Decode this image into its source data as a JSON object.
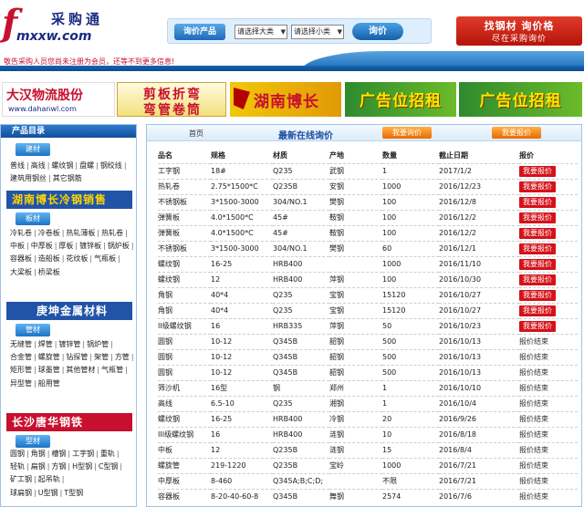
{
  "header": {
    "logo_mark": "f",
    "logo_cn": "采购通",
    "logo_en": "mxxw.com",
    "search_label": "询价产品",
    "select_1": "请选择大类",
    "select_2": "请选择小类",
    "search_button": "询价",
    "promo_line1": "找钢材 询价格",
    "promo_line2": "尽在采购询价",
    "notice": "敬告采购人员您尚未注册为会员，还等不到更多信息!"
  },
  "banners": {
    "b1_title": "大汉物流股份",
    "b1_sub": "www.dahanwl.com",
    "b2_line1": "剪板折弯",
    "b2_line2": "弯管卷筒",
    "b3_title": "湖南博长",
    "b4_title": "广告位招租",
    "b5_title": "广告位招租"
  },
  "sidebar": {
    "title": "产品目录",
    "categories": [
      {
        "tag": "建材",
        "links": [
          "普线",
          "高线",
          "螺纹钢",
          "盘螺",
          "钢绞线",
          "建筑用钢丝",
          "其它钢筋"
        ]
      },
      {
        "tag": "板材",
        "links": [
          "冷轧卷",
          "冷卷板",
          "热轧薄板",
          "热轧卷",
          "中板",
          "中厚板",
          "厚板",
          "镀锌板",
          "锅炉板",
          "容器板",
          "造船板",
          "花纹板",
          "气瓶板",
          "大梁板",
          "桥梁板"
        ]
      },
      {
        "tag": "管材",
        "links": [
          "无缝管",
          "焊管",
          "镀锌管",
          "锅炉管",
          "合金管",
          "螺旋管",
          "钻探管",
          "架管",
          "方管",
          "矩形管",
          "球墨管",
          "其他管材",
          "气瓶管",
          "异型管",
          "船用管"
        ]
      },
      {
        "tag": "型材",
        "links": [
          "圆钢",
          "角钢",
          "槽钢",
          "工字钢",
          "重轨",
          "轻轨",
          "扁钢",
          "方钢",
          "H型钢",
          "C型钢",
          "矿工钢",
          "起吊轨",
          "球扁钢",
          "U型钢",
          "T型钢"
        ]
      }
    ],
    "banner_1": "湖南博长冷钢销售",
    "banner_2": "庚坤金属材料",
    "banner_3": "长沙唐华钢铁"
  },
  "main": {
    "home": "首页",
    "title": "最新在线询价",
    "btn_inquiry": "我要询价",
    "btn_quote": "我要报价",
    "columns": [
      "品名",
      "规格",
      "材质",
      "产地",
      "数量",
      "截止日期",
      "报价"
    ],
    "rows": [
      [
        "工字钢",
        "18#",
        "Q235",
        "武钢",
        "1",
        "2017/1/2",
        "我要报价"
      ],
      [
        "热轧卷",
        "2.75*1500*C",
        "Q235B",
        "安钢",
        "1000",
        "2016/12/23",
        "我要报价"
      ],
      [
        "不锈钢板",
        "3*1500-3000",
        "304/NO.1",
        "樊钢",
        "100",
        "2016/12/8",
        "我要报价"
      ],
      [
        "弹簧板",
        "4.0*1500*C",
        "45#",
        "鞍钢",
        "100",
        "2016/12/2",
        "我要报价"
      ],
      [
        "弹簧板",
        "4.0*1500*C",
        "45#",
        "鞍钢",
        "100",
        "2016/12/2",
        "我要报价"
      ],
      [
        "不锈钢板",
        "3*1500-3000",
        "304/NO.1",
        "樊钢",
        "60",
        "2016/12/1",
        "我要报价"
      ],
      [
        "螺纹钢",
        "16-25",
        "HRB400",
        "",
        "1000",
        "2016/11/10",
        "我要报价"
      ],
      [
        "螺纹钢",
        "12",
        "HRB400",
        "萍钢",
        "100",
        "2016/10/30",
        "我要报价"
      ],
      [
        "角钢",
        "40*4",
        "Q235",
        "宝钢",
        "15120",
        "2016/10/27",
        "我要报价"
      ],
      [
        "角钢",
        "40*4",
        "Q235",
        "宝钢",
        "15120",
        "2016/10/27",
        "我要报价"
      ],
      [
        "II级螺纹钢",
        "16",
        "HRB335",
        "萍钢",
        "50",
        "2016/10/23",
        "我要报价"
      ],
      [
        "圆钢",
        "10-12",
        "Q345B",
        "韶钢",
        "500",
        "2016/10/13",
        "报价结束"
      ],
      [
        "圆钢",
        "10-12",
        "Q345B",
        "韶钢",
        "500",
        "2016/10/13",
        "报价结束"
      ],
      [
        "圆钢",
        "10-12",
        "Q345B",
        "韶钢",
        "500",
        "2016/10/13",
        "报价结束"
      ],
      [
        "筛沙机",
        "16型",
        "钢",
        "郑州",
        "1",
        "2016/10/10",
        "报价结束"
      ],
      [
        "高线",
        "6.5-10",
        "Q235",
        "湘钢",
        "1",
        "2016/10/4",
        "报价结束"
      ],
      [
        "螺纹钢",
        "16-25",
        "HRB400",
        "冷钢",
        "20",
        "2016/9/26",
        "报价结束"
      ],
      [
        "III级螺纹钢",
        "16",
        "HRB400",
        "涟钢",
        "10",
        "2016/8/18",
        "报价结束"
      ],
      [
        "中板",
        "12",
        "Q235B",
        "涟钢",
        "15",
        "2016/8/4",
        "报价结束"
      ],
      [
        "螺旋管",
        "219-1220",
        "Q235B",
        "宝岭",
        "1000",
        "2016/7/21",
        "报价结束"
      ],
      [
        "中厚板",
        "8-460",
        "Q345A;B;C;D;",
        "",
        "不限",
        "2016/7/21",
        "报价结束"
      ],
      [
        "容器板",
        "8-20-40-60-8",
        "Q345B",
        "舞钢",
        "2574",
        "2016/7/6",
        "报价结束"
      ]
    ]
  },
  "colors": {
    "brand_blue": "#1666b4",
    "status_red": "#d4121a",
    "orange": "#e86a00"
  }
}
